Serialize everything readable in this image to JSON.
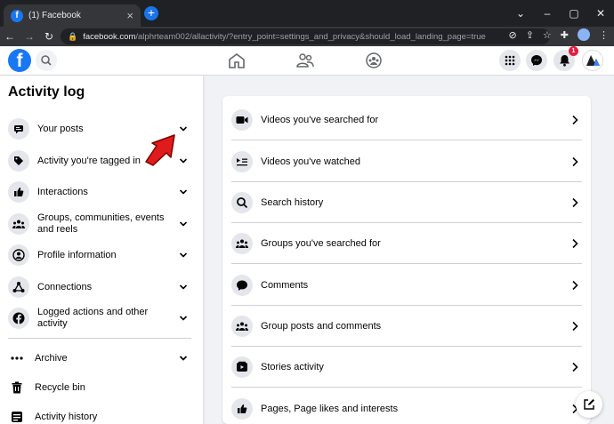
{
  "browser": {
    "tab_title": "(1) Facebook",
    "tab_favicon": "f",
    "new_tab": "+",
    "url_domain": "facebook.com",
    "url_path": "/alphrteam002/allactivity/?entry_point=settings_and_privacy&should_load_landing_page=true"
  },
  "topbar": {
    "logo": "f",
    "notification_count": "1",
    "brand_color": "#1877f2"
  },
  "sidebar": {
    "title": "Activity log",
    "items": [
      {
        "label": "Your posts",
        "icon": "post-icon"
      },
      {
        "label": "Activity you're tagged in",
        "icon": "tag-icon"
      },
      {
        "label": "Interactions",
        "icon": "thumbs-up-icon"
      },
      {
        "label": "Groups, communities, events and reels",
        "icon": "groups-icon"
      },
      {
        "label": "Profile information",
        "icon": "profile-icon"
      },
      {
        "label": "Connections",
        "icon": "connections-icon"
      },
      {
        "label": "Logged actions and other activity",
        "icon": "facebook-icon"
      }
    ],
    "extra": [
      {
        "label": "Archive",
        "icon": "archive-icon"
      },
      {
        "label": "Recycle bin",
        "icon": "trash-icon"
      },
      {
        "label": "Activity history",
        "icon": "history-icon"
      }
    ]
  },
  "main": {
    "rows": [
      {
        "label": "Videos you've searched for",
        "icon": "video-camera-icon"
      },
      {
        "label": "Videos you've watched",
        "icon": "video-list-icon"
      },
      {
        "label": "Search history",
        "icon": "search-icon"
      },
      {
        "label": "Groups you've searched for",
        "icon": "groups-icon"
      },
      {
        "label": "Comments",
        "icon": "comment-icon"
      },
      {
        "label": "Group posts and comments",
        "icon": "groups-icon"
      },
      {
        "label": "Stories activity",
        "icon": "stories-icon"
      },
      {
        "label": "Pages, Page likes and interests",
        "icon": "thumbs-up-icon"
      }
    ]
  },
  "annotation_color": "#e01b1b"
}
